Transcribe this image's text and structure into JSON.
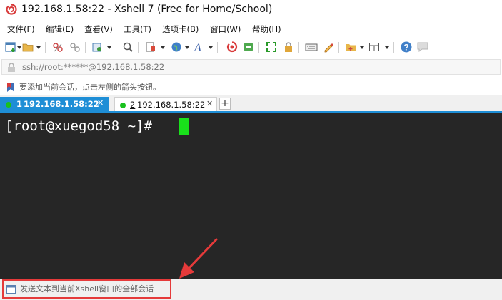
{
  "window": {
    "title": "192.168.1.58:22 - Xshell 7 (Free for Home/School)",
    "app_icon": "xshell-logo-icon"
  },
  "menu": [
    {
      "label": "文件(F)"
    },
    {
      "label": "编辑(E)"
    },
    {
      "label": "查看(V)"
    },
    {
      "label": "工具(T)"
    },
    {
      "label": "选项卡(B)"
    },
    {
      "label": "窗口(W)"
    },
    {
      "label": "帮助(H)"
    }
  ],
  "toolbar": {
    "icons": [
      "new-session-icon",
      "open-folder-icon",
      "disconnect-icon",
      "reconnect-icon",
      "transfer-settings-icon",
      "find-icon",
      "properties-icon",
      "globe-icon",
      "font-icon",
      "xftp-icon",
      "xagent-icon",
      "fullscreen-icon",
      "lock-icon",
      "keyboard-icon",
      "highlight-icon",
      "new-folder-icon",
      "layout-icon",
      "help-icon",
      "chat-icon"
    ]
  },
  "address": {
    "value": "ssh://root:******@192.168.1.58:22"
  },
  "hint": {
    "text": "要添加当前会话，点击左侧的箭头按钮。"
  },
  "tabs": [
    {
      "number": "1",
      "label": "192.168.1.58:22",
      "active": true
    },
    {
      "number": "2",
      "label": "192.168.1.58:22",
      "active": false
    }
  ],
  "new_tab_label": "+",
  "terminal": {
    "prompt": "[root@xuegod58 ~]# "
  },
  "send_bar": {
    "text": "发送文本到当前Xshell窗口的全部会话"
  },
  "colors": {
    "accent_tab": "#1e8ed6",
    "terminal_bg": "#262626",
    "cursor": "#19e01b",
    "annotation": "#e53a3a",
    "status_dot": "#19c11e"
  }
}
